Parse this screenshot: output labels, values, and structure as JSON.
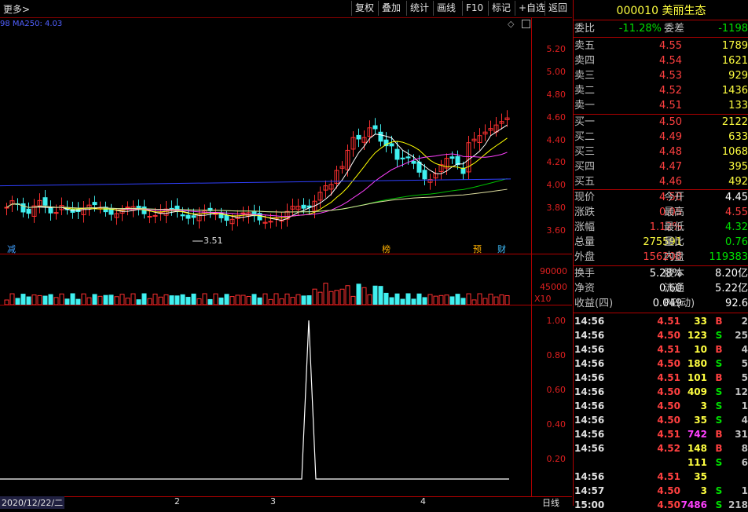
{
  "toolbar": {
    "more": "更多>",
    "buttons": [
      "复权",
      "叠加",
      "统计",
      "画线",
      "F10",
      "标记",
      "+自选",
      "返回"
    ]
  },
  "chart": {
    "ma_label": "98  MA250: 4.03",
    "price_ticks": [
      "5.20",
      "5.00",
      "4.80",
      "4.60",
      "4.40",
      "4.20",
      "4.00",
      "3.80",
      "3.60"
    ],
    "low_marker": "3.51",
    "vol_ticks": [
      "90000",
      "45000"
    ],
    "vol_unit": "X10",
    "ind_ticks": [
      "1.00",
      "0.80",
      "0.60",
      "0.40",
      "0.20"
    ],
    "events": [
      {
        "text": "减",
        "color": "#40a0ff"
      },
      {
        "text": "榜",
        "color": "#ffb000"
      },
      {
        "text": "预",
        "color": "#ffb000"
      },
      {
        "text": "财",
        "color": "#40c0ff"
      }
    ],
    "dates": [
      "2020/12/22/二",
      "2",
      "3",
      "4"
    ],
    "period": "日线",
    "colors": {
      "up": "#ff3030",
      "down": "#40f0f0",
      "ma5": "#ffffff",
      "ma10": "#ffff00",
      "ma20": "#ff40ff",
      "ma60": "#00c000",
      "ma120": "#e0e0a0",
      "ma250": "#3040ff"
    }
  },
  "quote": {
    "code": "000010",
    "name": "美丽生态",
    "weibi_label": "委比",
    "weibi": "-11.28%",
    "weicha_label": "委差",
    "weicha": "-1198",
    "asks": [
      {
        "label": "卖五",
        "price": "4.55",
        "vol": "1789"
      },
      {
        "label": "卖四",
        "price": "4.54",
        "vol": "1621"
      },
      {
        "label": "卖三",
        "price": "4.53",
        "vol": "929"
      },
      {
        "label": "卖二",
        "price": "4.52",
        "vol": "1436"
      },
      {
        "label": "卖一",
        "price": "4.51",
        "vol": "133"
      }
    ],
    "bids": [
      {
        "label": "买一",
        "price": "4.50",
        "vol": "2122"
      },
      {
        "label": "买二",
        "price": "4.49",
        "vol": "633"
      },
      {
        "label": "买三",
        "price": "4.48",
        "vol": "1068"
      },
      {
        "label": "买四",
        "price": "4.47",
        "vol": "395"
      },
      {
        "label": "买五",
        "price": "4.46",
        "vol": "492"
      }
    ],
    "stats": [
      {
        "l1": "现价",
        "v1": "4.50",
        "c1": "red",
        "l2": "今开",
        "v2": "4.45",
        "c2": "wht"
      },
      {
        "l1": "涨跌",
        "v1": "0.05",
        "c1": "red",
        "l2": "最高",
        "v2": "4.55",
        "c2": "red"
      },
      {
        "l1": "涨幅",
        "v1": "1.12%",
        "c1": "red",
        "l2": "最低",
        "v2": "4.32",
        "c2": "green"
      },
      {
        "l1": "总量",
        "v1": "275591",
        "c1": "yel",
        "l2": "量比",
        "v2": "0.76",
        "c2": "green"
      },
      {
        "l1": "外盘",
        "v1": "156208",
        "c1": "red",
        "l2": "内盘",
        "v2": "119383",
        "c2": "green"
      }
    ],
    "stats2": [
      {
        "l1": "换手",
        "v1": "5.28%",
        "l2": "股本",
        "v2": "8.20亿"
      },
      {
        "l1": "净资",
        "v1": "0.60",
        "l2": "流通",
        "v2": "5.22亿"
      },
      {
        "l1": "收益(四)",
        "v1": "0.049",
        "l2": "PE(动)",
        "v2": "92.6"
      }
    ],
    "ticks": [
      {
        "time": "14:56",
        "price": "4.51",
        "pc": "red",
        "vol": "33",
        "vc": "yel",
        "dir": "B",
        "dc": "red",
        "cnt": "2"
      },
      {
        "time": "14:56",
        "price": "4.50",
        "pc": "red",
        "vol": "123",
        "vc": "yel",
        "dir": "S",
        "dc": "green",
        "cnt": "25"
      },
      {
        "time": "14:56",
        "price": "4.51",
        "pc": "red",
        "vol": "10",
        "vc": "yel",
        "dir": "B",
        "dc": "red",
        "cnt": "4"
      },
      {
        "time": "14:56",
        "price": "4.50",
        "pc": "red",
        "vol": "180",
        "vc": "yel",
        "dir": "S",
        "dc": "green",
        "cnt": "5"
      },
      {
        "time": "14:56",
        "price": "4.51",
        "pc": "red",
        "vol": "101",
        "vc": "yel",
        "dir": "B",
        "dc": "red",
        "cnt": "5"
      },
      {
        "time": "14:56",
        "price": "4.50",
        "pc": "red",
        "vol": "409",
        "vc": "yel",
        "dir": "S",
        "dc": "green",
        "cnt": "12"
      },
      {
        "time": "14:56",
        "price": "4.50",
        "pc": "red",
        "vol": "3",
        "vc": "yel",
        "dir": "S",
        "dc": "green",
        "cnt": "1"
      },
      {
        "time": "14:56",
        "price": "4.50",
        "pc": "red",
        "vol": "35",
        "vc": "yel",
        "dir": "S",
        "dc": "green",
        "cnt": "4"
      },
      {
        "time": "14:56",
        "price": "4.51",
        "pc": "red",
        "vol": "742",
        "vc": "mag",
        "dir": "B",
        "dc": "red",
        "cnt": "31"
      },
      {
        "time": "14:56",
        "price": "4.52",
        "pc": "red",
        "vol": "148",
        "vc": "yel",
        "dir": "B",
        "dc": "red",
        "cnt": "8"
      },
      {
        "time": "",
        "price": "",
        "pc": "red",
        "vol": "111",
        "vc": "yel",
        "dir": "S",
        "dc": "green",
        "cnt": "6"
      },
      {
        "time": "14:56",
        "price": "4.51",
        "pc": "red",
        "vol": "35",
        "vc": "yel",
        "dir": "",
        "dc": "red",
        "cnt": ""
      },
      {
        "time": "14:57",
        "price": "4.50",
        "pc": "red",
        "vol": "3",
        "vc": "yel",
        "dir": "S",
        "dc": "green",
        "cnt": "1"
      },
      {
        "time": "15:00",
        "price": "4.50",
        "pc": "red",
        "vol": "7486",
        "vc": "mag",
        "dir": "S",
        "dc": "green",
        "cnt": "218"
      }
    ]
  }
}
